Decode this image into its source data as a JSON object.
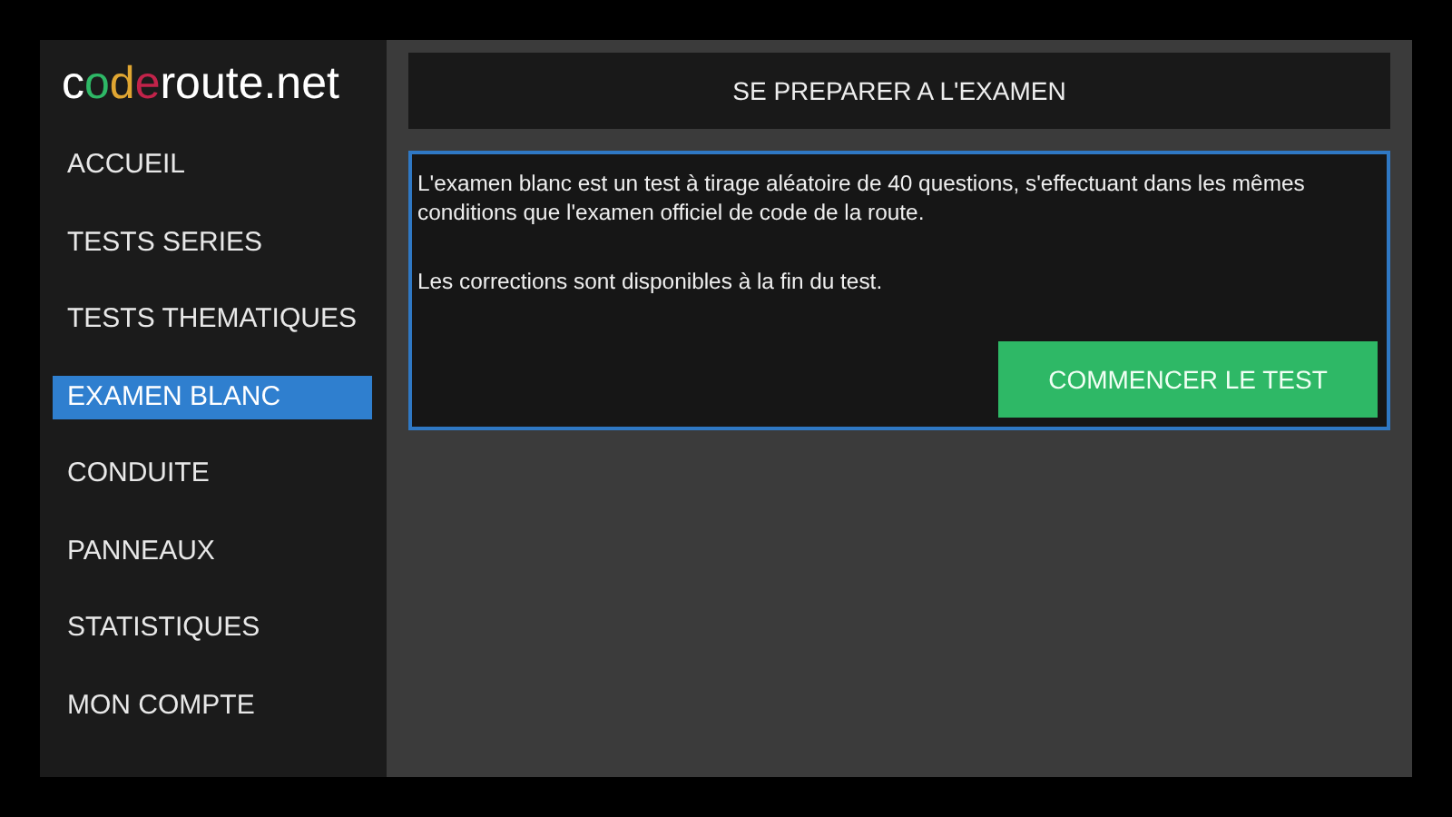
{
  "logo": "coderoute.net",
  "sidebar": {
    "items": [
      {
        "label": "ACCUEIL",
        "selected": false
      },
      {
        "label": "TESTS SERIES",
        "selected": false
      },
      {
        "label": "TESTS THEMATIQUES",
        "selected": false
      },
      {
        "label": "EXAMEN BLANC",
        "selected": true
      },
      {
        "label": "CONDUITE",
        "selected": false
      },
      {
        "label": "PANNEAUX",
        "selected": false
      },
      {
        "label": "STATISTIQUES",
        "selected": false
      },
      {
        "label": "MON COMPTE",
        "selected": false
      }
    ]
  },
  "header": {
    "title": "SE PREPARER A L'EXAMEN"
  },
  "card": {
    "paragraphs": [
      "L'examen blanc est un test à tirage aléatoire de 40 questions, s'effectuant dans les mêmes conditions que l'examen officiel de code de la route.",
      "Les corrections sont disponibles à la fin du test."
    ],
    "button": "COMMENCER LE TEST"
  }
}
